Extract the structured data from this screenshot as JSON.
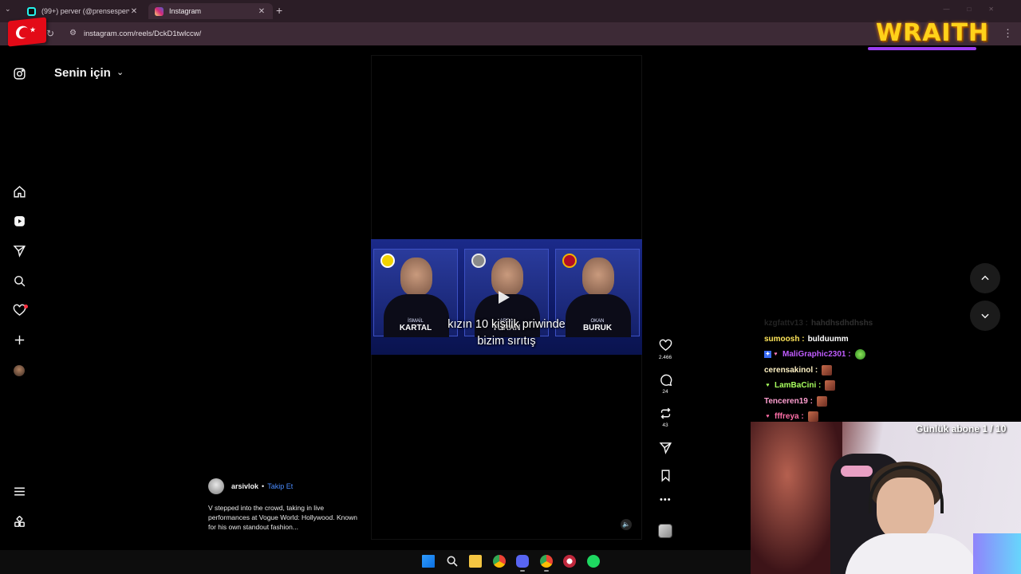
{
  "browser": {
    "tabs": [
      {
        "label": "(99+) perver (@prensesperver) |",
        "active": false
      },
      {
        "label": "Instagram",
        "active": true
      }
    ],
    "url": "instagram.com/reels/DckD1twlccw/"
  },
  "stream_overlay": {
    "logo_text": "WRAITH",
    "sub_goal": "Günlük abone 1 / 10",
    "chat": [
      {
        "user": "kzgfattv13",
        "message": "hahdhsdhdhshs",
        "color": "#bcbcbc",
        "faded": true
      },
      {
        "user": "sumoosh",
        "message": "bulduumm",
        "color": "#ffe65a"
      },
      {
        "user": "MaliGraphic2301",
        "message": "",
        "color": "#c05cff",
        "emote": "green"
      },
      {
        "user": "cerensakinol",
        "message": "",
        "color": "#fff2c4",
        "emote": "photo"
      },
      {
        "user": "LamBaCini",
        "message": "",
        "color": "#a8ff5e",
        "emote": "photo"
      },
      {
        "user": "Tenceren19",
        "message": "",
        "color": "#ff9fd0",
        "emote": "photo"
      },
      {
        "user": "fffreya",
        "message": "",
        "color": "#ff6fa8",
        "emote": "photo"
      }
    ]
  },
  "instagram": {
    "feed_title": "Senin için",
    "nav_icons": [
      "instagram-icon",
      "home-icon",
      "reels-icon",
      "send-icon",
      "search-icon",
      "heart-icon",
      "create-icon",
      "profile-avatar",
      "menu-icon",
      "meta-apps-icon"
    ],
    "reel": {
      "caption_line1": "kızın 10 kişilik priwinde",
      "caption_line2": "bizim sırıtış",
      "coaches": [
        {
          "first": "İSMAİL",
          "last": "KARTAL"
        },
        {
          "first": "ARDA",
          "last": "TURAN"
        },
        {
          "first": "OKAN",
          "last": "BURUK"
        }
      ],
      "author": "arsivlok",
      "separator": "•",
      "follow_label": "Takip Et",
      "description": "V stepped into the crowd, taking in live performances at Vogue World: Hollywood. Known for his own standout fashion...",
      "likes": "2.466",
      "comments": "24",
      "reposts": "43"
    }
  }
}
